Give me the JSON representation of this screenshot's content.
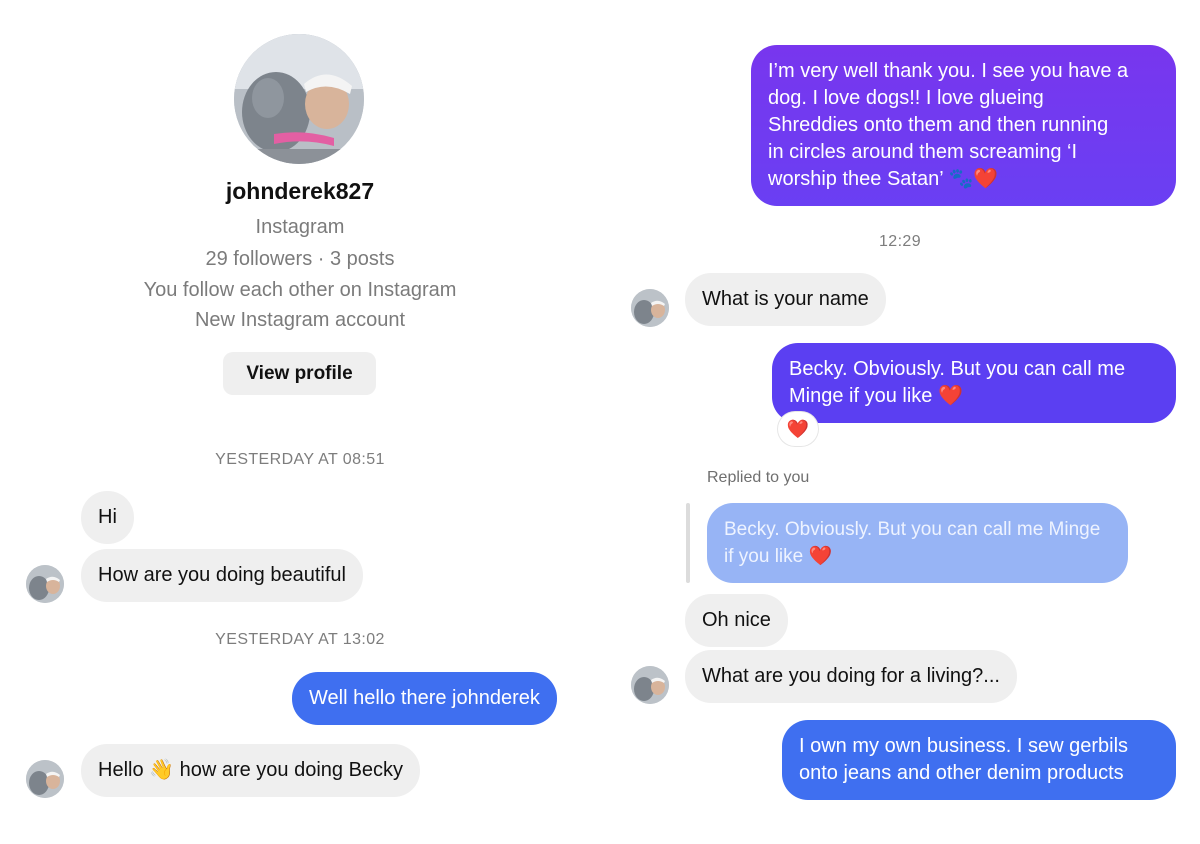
{
  "profile": {
    "username": "johnderek827",
    "platform": "Instagram",
    "stats": "29 followers · 3 posts",
    "mutual": "You follow each other on Instagram",
    "account_note": "New Instagram account",
    "view_profile_label": "View profile"
  },
  "left_thread": {
    "stamp_1": "YESTERDAY AT 08:51",
    "msg_hi": "Hi",
    "msg_how": "How are you doing beautiful",
    "stamp_2": "YESTERDAY AT 13:02",
    "msg_hello_out": "Well hello there johnderek",
    "msg_hello_in": "Hello 👋 how are you doing Becky"
  },
  "right_thread": {
    "msg_dog": [
      "I’m very well thank you. I see you have a",
      "dog. I love dogs!! I love glueing",
      "Shreddies onto them and then running",
      "in circles around them screaming ‘I",
      "worship thee Satan’ 🐾❤️"
    ],
    "stamp_time": "12:29",
    "msg_name_q": "What is your name",
    "msg_becky": [
      "Becky. Obviously. But you can call me",
      "Minge if you like ❤️"
    ],
    "reaction": "❤️",
    "replied_label": "Replied to you",
    "quoted": [
      "Becky. Obviously. But you can call me Minge",
      "if you like ❤️"
    ],
    "msg_nice": "Oh nice",
    "msg_living": "What are you doing for a living?...",
    "msg_business": [
      "I own my own business. I sew gerbils",
      "onto jeans and other denim products"
    ]
  },
  "colors": {
    "incoming": "#efefef",
    "outgoing_blue": "#3f6ff0",
    "outgoing_indigo": "#5b3ff2",
    "outgoing_violet": "#6d35ee",
    "quoted": "#97b4f5"
  }
}
